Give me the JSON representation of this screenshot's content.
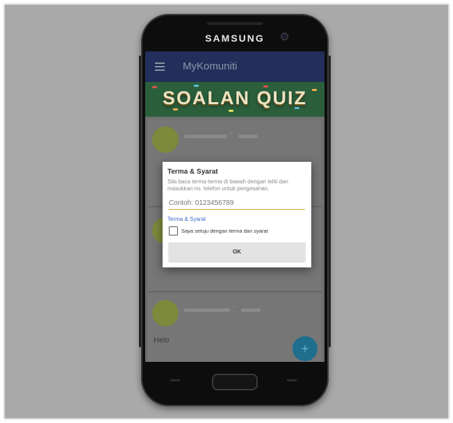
{
  "device": {
    "brand": "SAMSUNG"
  },
  "app": {
    "title": "MyKomuniti",
    "menu_icon": "hamburger-menu-icon",
    "banner_title": "SOALAN QUIZ"
  },
  "feed": {
    "items": [
      {
        "text": "",
        "sub": ""
      },
      {
        "text": "",
        "sub": ""
      },
      {
        "text": "Helo",
        "sub": ""
      }
    ]
  },
  "fab": {
    "icon": "add-icon"
  },
  "dialog": {
    "title": "Terma & Syarat",
    "message": "Sila baca terma-terma di bawah dengan teliti dan masukkan no. telefon untuk pengesahan.",
    "phone_placeholder": "Contoh: 0123456789",
    "phone_value": "",
    "terms_link": "Terma & Syarat",
    "agree_label": "Saya setuju dengan terma dan syarat",
    "agree_checked": false,
    "ok_label": "OK"
  },
  "colors": {
    "appbar": "#232f5a",
    "banner": "#2b5f3c",
    "input_underline": "#e5a42d",
    "link": "#3c6bc8",
    "fab": "#1f6e8e"
  }
}
